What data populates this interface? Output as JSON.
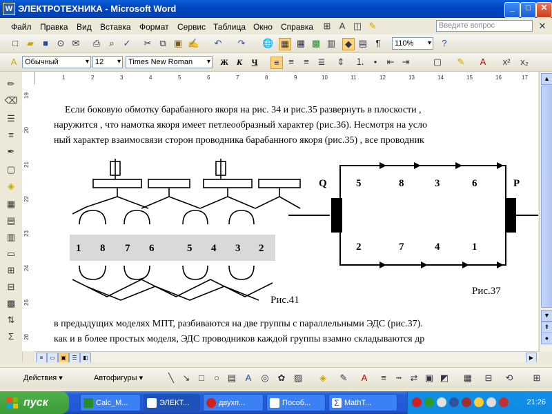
{
  "window": {
    "title": "ЭЛЕКТРОТЕХНИКА - Microsoft Word",
    "min": "_",
    "max": "□",
    "close": "✕"
  },
  "menu": {
    "items": [
      "Файл",
      "Правка",
      "Вид",
      "Вставка",
      "Формат",
      "Сервис",
      "Таблица",
      "Окно",
      "Справка"
    ],
    "help_placeholder": "Введите вопрос"
  },
  "format_bar": {
    "style": "Обычный",
    "size": "12",
    "font": "Times New Roman",
    "zoom": "110%"
  },
  "document": {
    "para1": [
      "Если  боковую  обмотку  барабанного  якоря  на рис. 34 и рис.35  развернуть  в  плоскости  ,",
      "наружится , что намотка  якоря  имеет  петлеообразный  характер (рис.36). Несмотря  на  усло",
      "ный  характер  взаимосвязи  сторон проводника  барабанного  якоря (рис.35) , все  проводник"
    ],
    "para2": [
      "в  предыдущих  моделях МПТ, разбиваются  на две группы  с  параллельными  ЭДС (рис.37).",
      "как  и в более  простых моделя, ЭДС проводников каждой  группы взамно  складываются  др"
    ],
    "fig41": {
      "numbers": [
        "1",
        "8",
        "7",
        "6",
        "5",
        "4",
        "3",
        "2"
      ],
      "caption": "Рис.41"
    },
    "fig37": {
      "left": "Q",
      "right": "P",
      "top": [
        "5",
        "8",
        "3",
        "6"
      ],
      "bottom": [
        "2",
        "7",
        "4",
        "1"
      ],
      "caption": "Рис.37"
    }
  },
  "drawing_bar": {
    "actions": "Действия ▾",
    "autoshapes": "Автофигуры ▾"
  },
  "taskbar": {
    "start": "пуск",
    "tasks": [
      "Calc_M...",
      "ЭЛЕКТ...",
      "двухп...",
      "Пособ...",
      "MathT..."
    ],
    "clock": "21:26"
  },
  "colors": {
    "titlebar": "#0a5fd9",
    "taskbar": "#245edb",
    "start": "#3b9b36"
  }
}
